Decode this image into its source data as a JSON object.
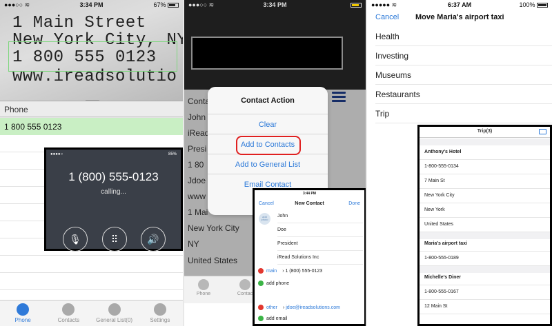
{
  "panel1": {
    "status": {
      "time": "3:34 PM",
      "battery": "67%"
    },
    "camera_lines": [
      "1 Main Street",
      "New York City, NY",
      "1 800 555 0123",
      "www.ireadsolutio"
    ],
    "phone_header": "Phone",
    "phone_value": "1 800 555 0123",
    "call": {
      "number": "1 (800) 555-0123",
      "status": "calling...",
      "battery": "85%"
    },
    "tabs": [
      {
        "label": "Phone",
        "active": true
      },
      {
        "label": "Contacts"
      },
      {
        "label": "General List(0)"
      },
      {
        "label": "Settings"
      }
    ]
  },
  "panel2": {
    "status": {
      "time": "3:34 PM"
    },
    "list": [
      "Conta",
      "John",
      "iRead",
      "Presi",
      "1 80",
      "Jdoe",
      "www",
      "1 Mai",
      "New York City",
      "NY",
      "United States"
    ],
    "action_sheet": {
      "title": "Contact Action",
      "options": [
        "Clear",
        "Add to Contacts",
        "Add to General List",
        "Email Contact"
      ],
      "highlighted": "Add to Contacts"
    },
    "bottom_tabs": [
      "Phone",
      "Contac"
    ],
    "new_contact": {
      "time": "3:44 PM",
      "cancel": "Cancel",
      "title": "New Contact",
      "done": "Done",
      "add_photo": "add photo",
      "fields": [
        "John",
        "Doe",
        "President",
        "iRead Solutions Inc"
      ],
      "phone_label": "main",
      "phone_value": "1 (800) 555-0123",
      "add_phone": "add phone",
      "email_label": "other",
      "email_value": "jdoe@ireadsolutions.com",
      "add_email": "add email"
    }
  },
  "panel3": {
    "status": {
      "time": "6:37 AM",
      "battery": "100%"
    },
    "cancel": "Cancel",
    "title": "Move Maria's airport taxi",
    "categories": [
      "Health",
      "Investing",
      "Museums",
      "Restaurants",
      "Trip"
    ],
    "trip": {
      "title": "Trip(3)",
      "sections": [
        {
          "name": "Anthony's Hotel",
          "rows": [
            "1-800-555-0134",
            "7 Main St",
            "New York City",
            "New York",
            "United States"
          ]
        },
        {
          "name": "Maria's airport taxi",
          "rows": [
            "1-800-555-0189"
          ]
        },
        {
          "name": "Michelle's Diner",
          "rows": [
            "1-800-555-0167",
            "12 Main St"
          ]
        }
      ]
    }
  }
}
